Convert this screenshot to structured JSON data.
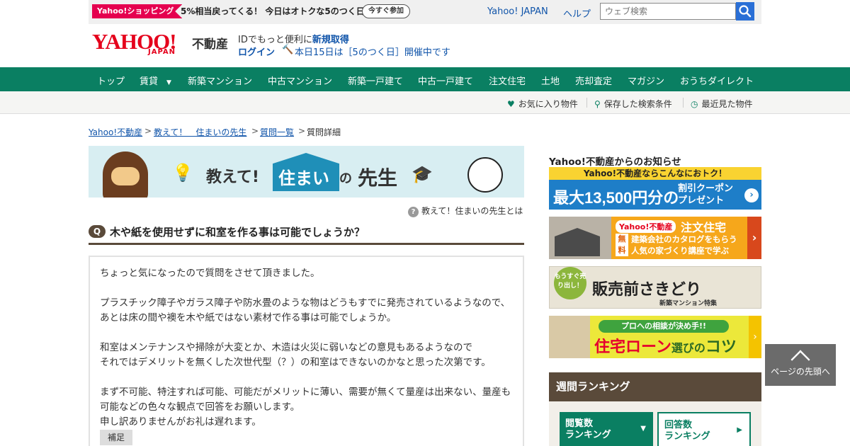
{
  "promo": {
    "tag": "Yahoo!ショッピング",
    "text": "5%相当戻ってくる！ 今日はオトクな5のつく日",
    "button": "今すぐ参加"
  },
  "top_links": {
    "yahoo_japan": "Yahoo! JAPAN",
    "help": "ヘルプ"
  },
  "search": {
    "placeholder": "ウェブ検索"
  },
  "header": {
    "logo": "YAHOO!",
    "logo_sub": "JAPAN",
    "service": "不動産",
    "id_text": "IDでもっと便利に",
    "id_link": "新規取得",
    "login": "ログイン",
    "event": "本日15日は［5のつく日］開催中です"
  },
  "nav": [
    "トップ",
    "賃貸",
    "新築マンション",
    "中古マンション",
    "新築一戸建て",
    "中古一戸建て",
    "注文住宅",
    "土地",
    "売却査定",
    "マガジン",
    "おうちダイレクト"
  ],
  "nav_dropdown_icon": "▼",
  "subnav": {
    "favorites": "お気に入り物件",
    "saved_search": "保存した検索条件",
    "recent": "最近見た物件"
  },
  "breadcrumb": {
    "home": "Yahoo!不動産",
    "sensei": "教えて！　住まいの先生",
    "list": "質問一覧",
    "current": "質問詳細",
    "separator": ">"
  },
  "banner": {
    "part1": "教えて!",
    "part2": "住まい",
    "part3": "の",
    "part4": "先生"
  },
  "about_link": "教えて！住まいの先生とは",
  "question": {
    "badge": "Q",
    "title": "木や紙を使用せずに和室を作る事は可能でしょうか？",
    "paragraphs": [
      "ちょっと気になったので質問をさせて頂きました。",
      "プラスチック障子やガラス障子や防水畳のような物はどうもすでに発売されているようなので、あとは床の間や襖を木や紙ではない素材で作る事は可能でしょうか。",
      "和室はメンテナンスや掃除が大変とか、木造は火災に弱いなどの意見もあるようなので\nそれではデメリットを無くした次世代型（？）の和室はできないのかなと思った次第です。",
      "まず不可能、特注すれば可能、可能だがメリットに薄い、需要が無くて量産は出来ない、量産も可能などの色々な観点で回答をお願いします。\n申し訳ありませんがお礼は遅れます。"
    ],
    "supplement_label": "補足"
  },
  "sidebar": {
    "notice_title": "Yahoo!不動産からのお知らせ",
    "ad1": {
      "top": "Yahoo!不動産ならこんなにおトク！",
      "big": "最大13,500円分の",
      "line1": "割引クーポン",
      "line2": "プレゼント",
      "arrow": "›"
    },
    "ad2": {
      "badge": "Yahoo!不動産",
      "head": "注文住宅",
      "free": "無料",
      "line1": "建築会社のカタログをもらう",
      "line2": "人気の家づくり講座で学ぶ",
      "arrow": "›"
    },
    "ad3": {
      "badge": "もうすぐ売り出し！",
      "main": "販売前さきどり",
      "sub": "新築マンション特集"
    },
    "ad4": {
      "bubble": "プロへの相談が決め手!!",
      "main": "住宅ローン",
      "main_small": "選びの",
      "main_end": "コツ",
      "arrow": "›"
    },
    "ranking": {
      "title": "週間ランキング",
      "tab1_line1": "閲覧数",
      "tab1_line2": "ランキング",
      "tab2_line1": "回答数",
      "tab2_line2": "ランキング"
    }
  },
  "page_top": "ページの先頭へ",
  "colors": {
    "nav_green": "#0a7f62",
    "yahoo_red": "#e5001c",
    "link_blue": "#1155aa",
    "brown": "#5a4a3a"
  }
}
